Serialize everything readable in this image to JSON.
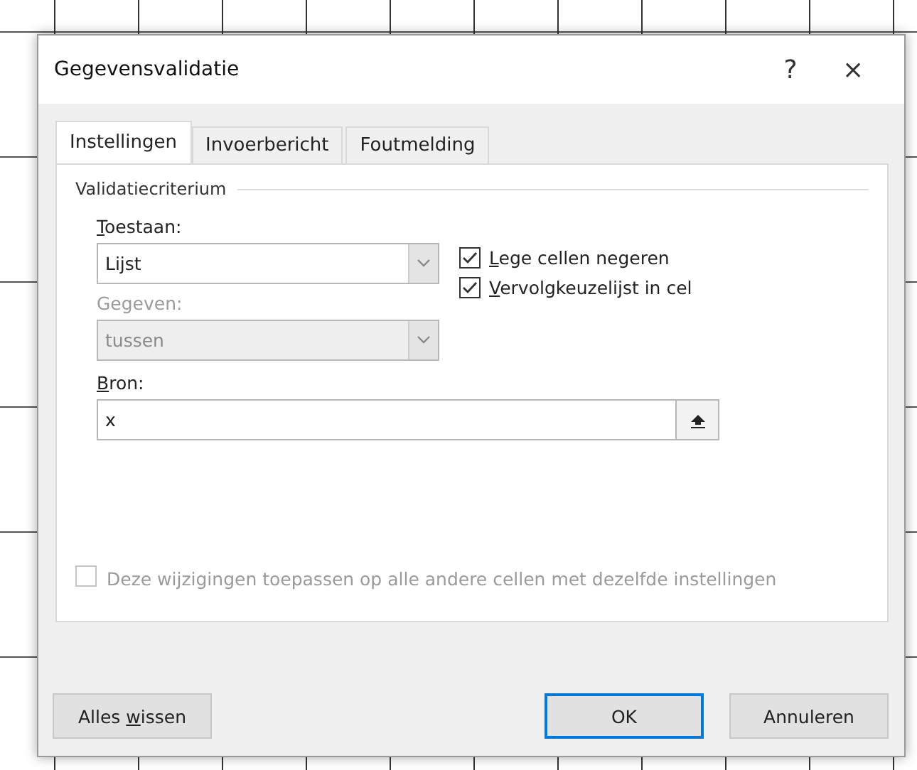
{
  "window": {
    "title": "Gegevensvalidatie",
    "help": "?",
    "close": "×"
  },
  "tabs": [
    {
      "label": "Instellingen",
      "selected": true
    },
    {
      "label": "Invoerbericht",
      "selected": false
    },
    {
      "label": "Foutmelding",
      "selected": false
    }
  ],
  "group_title": "Validatiecriterium",
  "allow": {
    "label": {
      "key": "T",
      "after": "oestaan:"
    },
    "value": "Lijst",
    "disabled": false
  },
  "data": {
    "label": {
      "before": "Gegeven:"
    },
    "value": "tussen",
    "disabled": true
  },
  "options": [
    {
      "label": {
        "key": "L",
        "after": "ege cellen negeren"
      },
      "checked": true
    },
    {
      "label": {
        "key": "V",
        "after": "ervolgkeuzelijst in cel"
      },
      "checked": true
    }
  ],
  "source": {
    "label": {
      "key": "B",
      "after": "ron:"
    },
    "value": "x"
  },
  "apply_all": {
    "label": "Deze wijzigingen toepassen op alle andere cellen met dezelfde instellingen",
    "checked": false,
    "disabled": true
  },
  "clear_button": {
    "label": {
      "before": "Alles ",
      "key": "w",
      "after": "issen"
    },
    "default": false
  },
  "buttons": [
    {
      "label": {
        "before": "OK"
      },
      "default": true
    },
    {
      "label": {
        "before": "Annuleren"
      },
      "default": false
    }
  ]
}
